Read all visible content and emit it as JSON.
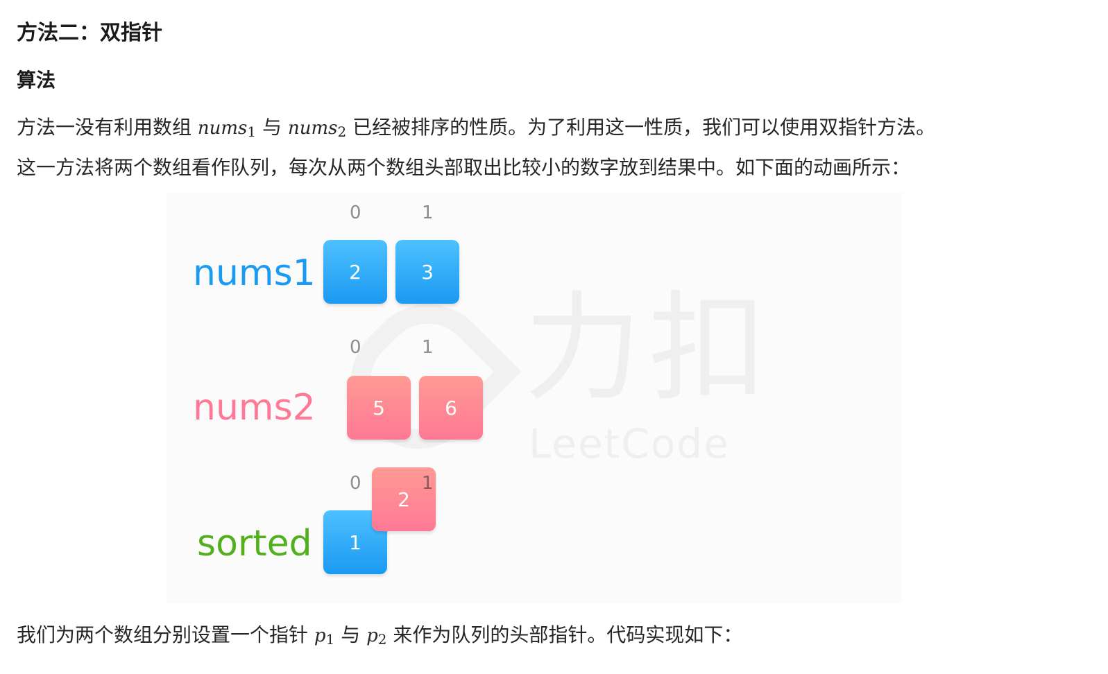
{
  "heading": "方法二：双指针",
  "subheading": "算法",
  "para1": {
    "text_a": "方法一没有利用数组 ",
    "m1_base": "nums",
    "m1_sub": "1",
    "text_b": " 与 ",
    "m2_base": "nums",
    "m2_sub": "2",
    "text_c": " 已经被排序的性质。为了利用这一性质，我们可以使用双指针方法。",
    "line2": "这一方法将两个数组看作队列，每次从两个数组头部取出比较小的数字放到结果中。如下面的动画所示："
  },
  "figure": {
    "watermark_cn": "力扣",
    "watermark_en": "LeetCode",
    "nums1": {
      "label": "nums1",
      "indices": [
        "0",
        "1"
      ],
      "values": [
        "2",
        "3"
      ]
    },
    "nums2": {
      "label": "nums2",
      "indices": [
        "0",
        "1"
      ],
      "values": [
        "5",
        "6"
      ]
    },
    "sorted": {
      "label": "sorted",
      "indices": [
        "0",
        "1"
      ],
      "values": [
        "1",
        "2"
      ]
    },
    "colors": {
      "nums1": "#1a9af2",
      "nums2": "#ff7895",
      "sorted": "#52b01e"
    }
  },
  "para2": {
    "text_a": "我们为两个数组分别设置一个指针 ",
    "p1_base": "p",
    "p1_sub": "1",
    "text_b": " 与 ",
    "p2_base": "p",
    "p2_sub": "2",
    "text_c": " 来作为队列的头部指针。代码实现如下："
  }
}
